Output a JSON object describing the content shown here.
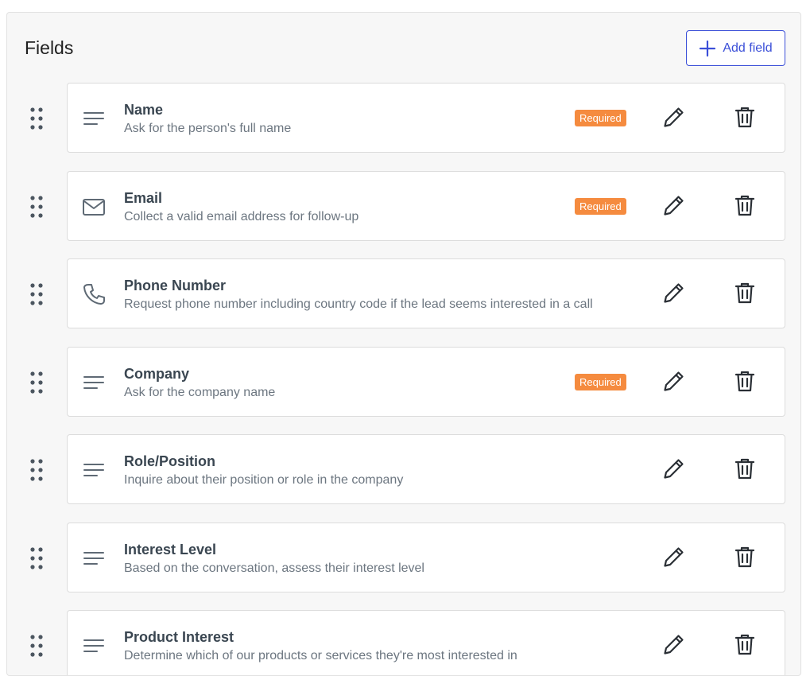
{
  "panel": {
    "title": "Fields",
    "add_button_label": "Add field"
  },
  "fields": [
    {
      "name": "Name",
      "description": "Ask for the person's full name",
      "icon": "text-lines-icon",
      "required": true,
      "required_label": "Required"
    },
    {
      "name": "Email",
      "description": "Collect a valid email address for follow-up",
      "icon": "envelope-icon",
      "required": true,
      "required_label": "Required"
    },
    {
      "name": "Phone Number",
      "description": "Request phone number including country code if the lead seems interested in a call",
      "icon": "phone-icon",
      "required": false,
      "required_label": ""
    },
    {
      "name": "Company",
      "description": "Ask for the company name",
      "icon": "text-lines-icon",
      "required": true,
      "required_label": "Required"
    },
    {
      "name": "Role/Position",
      "description": "Inquire about their position or role in the company",
      "icon": "text-lines-icon",
      "required": false,
      "required_label": ""
    },
    {
      "name": "Interest Level",
      "description": "Based on the conversation, assess their interest level",
      "icon": "text-lines-icon",
      "required": false,
      "required_label": ""
    },
    {
      "name": "Product Interest",
      "description": "Determine which of our products or services they're most interested in",
      "icon": "text-lines-icon",
      "required": false,
      "required_label": ""
    }
  ],
  "colors": {
    "accent": "#3b4fd8",
    "required_badge": "#f58b3f",
    "field_name": "#3a4651",
    "field_desc": "#6c7680"
  }
}
